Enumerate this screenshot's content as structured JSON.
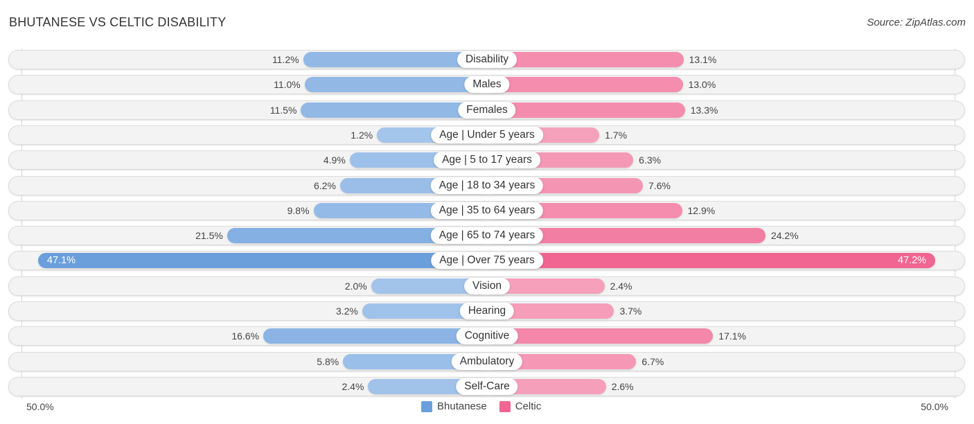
{
  "header": {
    "title": "BHUTANESE VS CELTIC DISABILITY",
    "source": "Source: ZipAtlas.com"
  },
  "colors": {
    "bhutanese": "#6a9fdc",
    "bhutanese_light": "#a9c8ec",
    "celtic": "#f06592",
    "celtic_light": "#f7a8c1"
  },
  "chart_data": {
    "type": "bar",
    "orientation": "horizontal-diverging",
    "title": "BHUTANESE VS CELTIC DISABILITY",
    "categories": [
      "Disability",
      "Males",
      "Females",
      "Age | Under 5 years",
      "Age | 5 to 17 years",
      "Age | 18 to 34 years",
      "Age | 35 to 64 years",
      "Age | 65 to 74 years",
      "Age | Over 75 years",
      "Vision",
      "Hearing",
      "Cognitive",
      "Ambulatory",
      "Self-Care"
    ],
    "series": [
      {
        "name": "Bhutanese",
        "side": "left",
        "values": [
          11.2,
          11.0,
          11.5,
          1.2,
          4.9,
          6.2,
          9.8,
          21.5,
          47.1,
          2.0,
          3.2,
          16.6,
          5.8,
          2.4
        ],
        "labels": [
          "11.2%",
          "11.0%",
          "11.5%",
          "1.2%",
          "4.9%",
          "6.2%",
          "9.8%",
          "21.5%",
          "47.1%",
          "2.0%",
          "3.2%",
          "16.6%",
          "5.8%",
          "2.4%"
        ]
      },
      {
        "name": "Celtic",
        "side": "right",
        "values": [
          13.1,
          13.0,
          13.3,
          1.7,
          6.3,
          7.6,
          12.9,
          24.2,
          47.2,
          2.4,
          3.7,
          17.1,
          6.7,
          2.6
        ],
        "labels": [
          "13.1%",
          "13.0%",
          "13.3%",
          "1.7%",
          "6.3%",
          "7.6%",
          "12.9%",
          "24.2%",
          "47.2%",
          "2.4%",
          "3.7%",
          "17.1%",
          "6.7%",
          "2.6%"
        ]
      }
    ],
    "xlim": [
      0,
      50
    ],
    "axis_labels": {
      "left": "50.0%",
      "right": "50.0%"
    },
    "legend": {
      "position": "bottom-center",
      "entries": [
        "Bhutanese",
        "Celtic"
      ]
    },
    "unit": "%"
  }
}
